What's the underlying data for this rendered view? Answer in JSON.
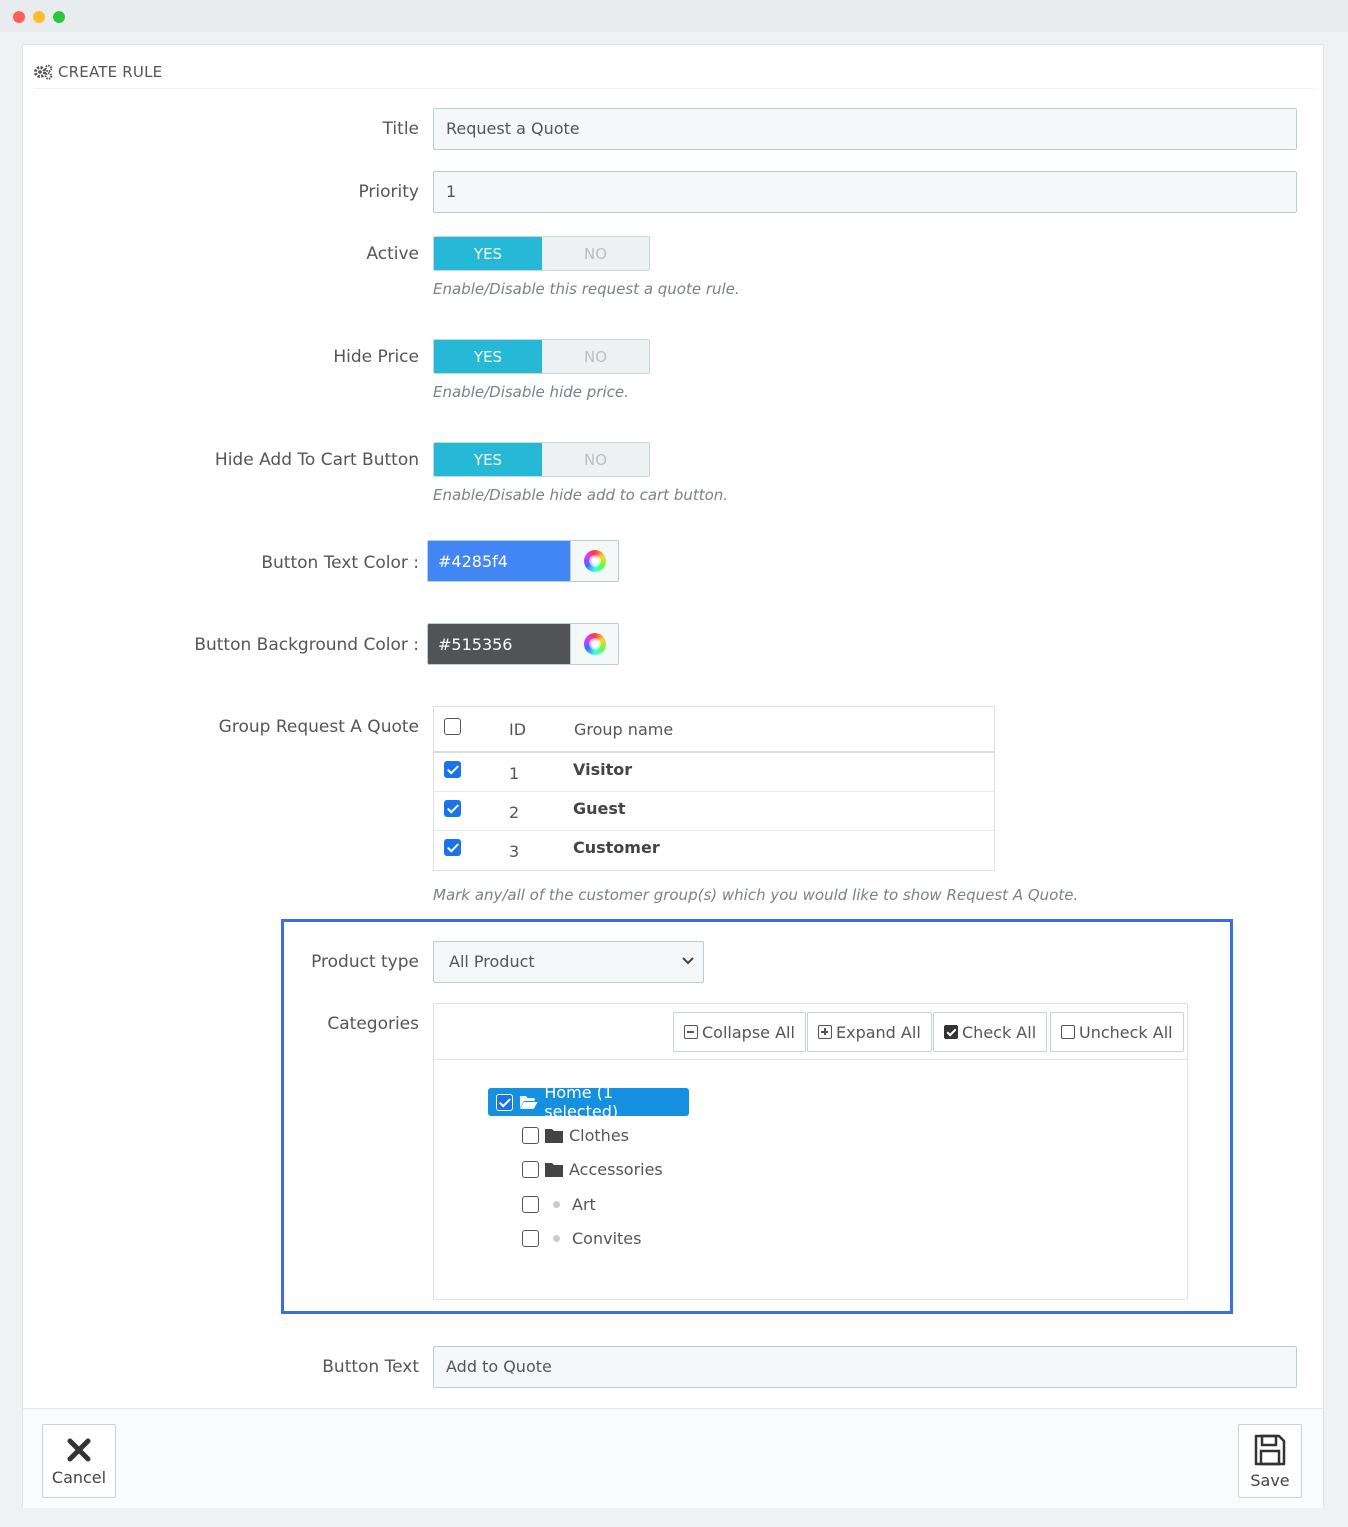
{
  "window": {
    "controls": [
      "close",
      "minimize",
      "maximize"
    ]
  },
  "panel": {
    "title": "CREATE RULE",
    "icon": "gears-icon"
  },
  "form": {
    "title": {
      "label": "Title",
      "value": "Request a Quote"
    },
    "priority": {
      "label": "Priority",
      "value": "1"
    },
    "active": {
      "label": "Active",
      "yes": "YES",
      "no": "NO",
      "selected": "YES",
      "help": "Enable/Disable this request a quote rule."
    },
    "hide_price": {
      "label": "Hide Price",
      "yes": "YES",
      "no": "NO",
      "selected": "YES",
      "help": "Enable/Disable hide price."
    },
    "hide_cart": {
      "label": "Hide Add To Cart Button",
      "yes": "YES",
      "no": "NO",
      "selected": "YES",
      "help": "Enable/Disable hide add to cart button."
    },
    "button_text_color": {
      "label": "Button Text Color :",
      "value": "#4285f4",
      "swatch": "#4285f4"
    },
    "button_bg_color": {
      "label": "Button Background Color :",
      "value": "#515356",
      "swatch": "#515356"
    },
    "groups": {
      "label": "Group Request A Quote",
      "columns": {
        "id": "ID",
        "name": "Group name"
      },
      "rows": [
        {
          "id": "1",
          "name": "Visitor",
          "checked": true
        },
        {
          "id": "2",
          "name": "Guest",
          "checked": true
        },
        {
          "id": "3",
          "name": "Customer",
          "checked": true
        }
      ],
      "help": "Mark any/all of the customer group(s) which you would like to show Request A Quote."
    },
    "product_type": {
      "label": "Product type",
      "value": "All Product"
    },
    "categories": {
      "label": "Categories",
      "toolbar": {
        "collapse": "Collapse All",
        "expand": "Expand All",
        "check": "Check All",
        "uncheck": "Uncheck All"
      },
      "root": {
        "label": "Home (1 selected)",
        "checked": true
      },
      "children": [
        {
          "label": "Clothes",
          "type": "folder",
          "checked": false
        },
        {
          "label": "Accessories",
          "type": "folder",
          "checked": false
        },
        {
          "label": "Art",
          "type": "leaf",
          "checked": false
        },
        {
          "label": "Convites",
          "type": "leaf",
          "checked": false
        }
      ]
    },
    "button_text": {
      "label": "Button Text",
      "value": "Add to Quote"
    }
  },
  "footer": {
    "cancel": "Cancel",
    "save": "Save"
  },
  "colors": {
    "accent": "#25b9d7",
    "highlight": "#3d6ee0",
    "tree_selected": "#1590e0"
  }
}
